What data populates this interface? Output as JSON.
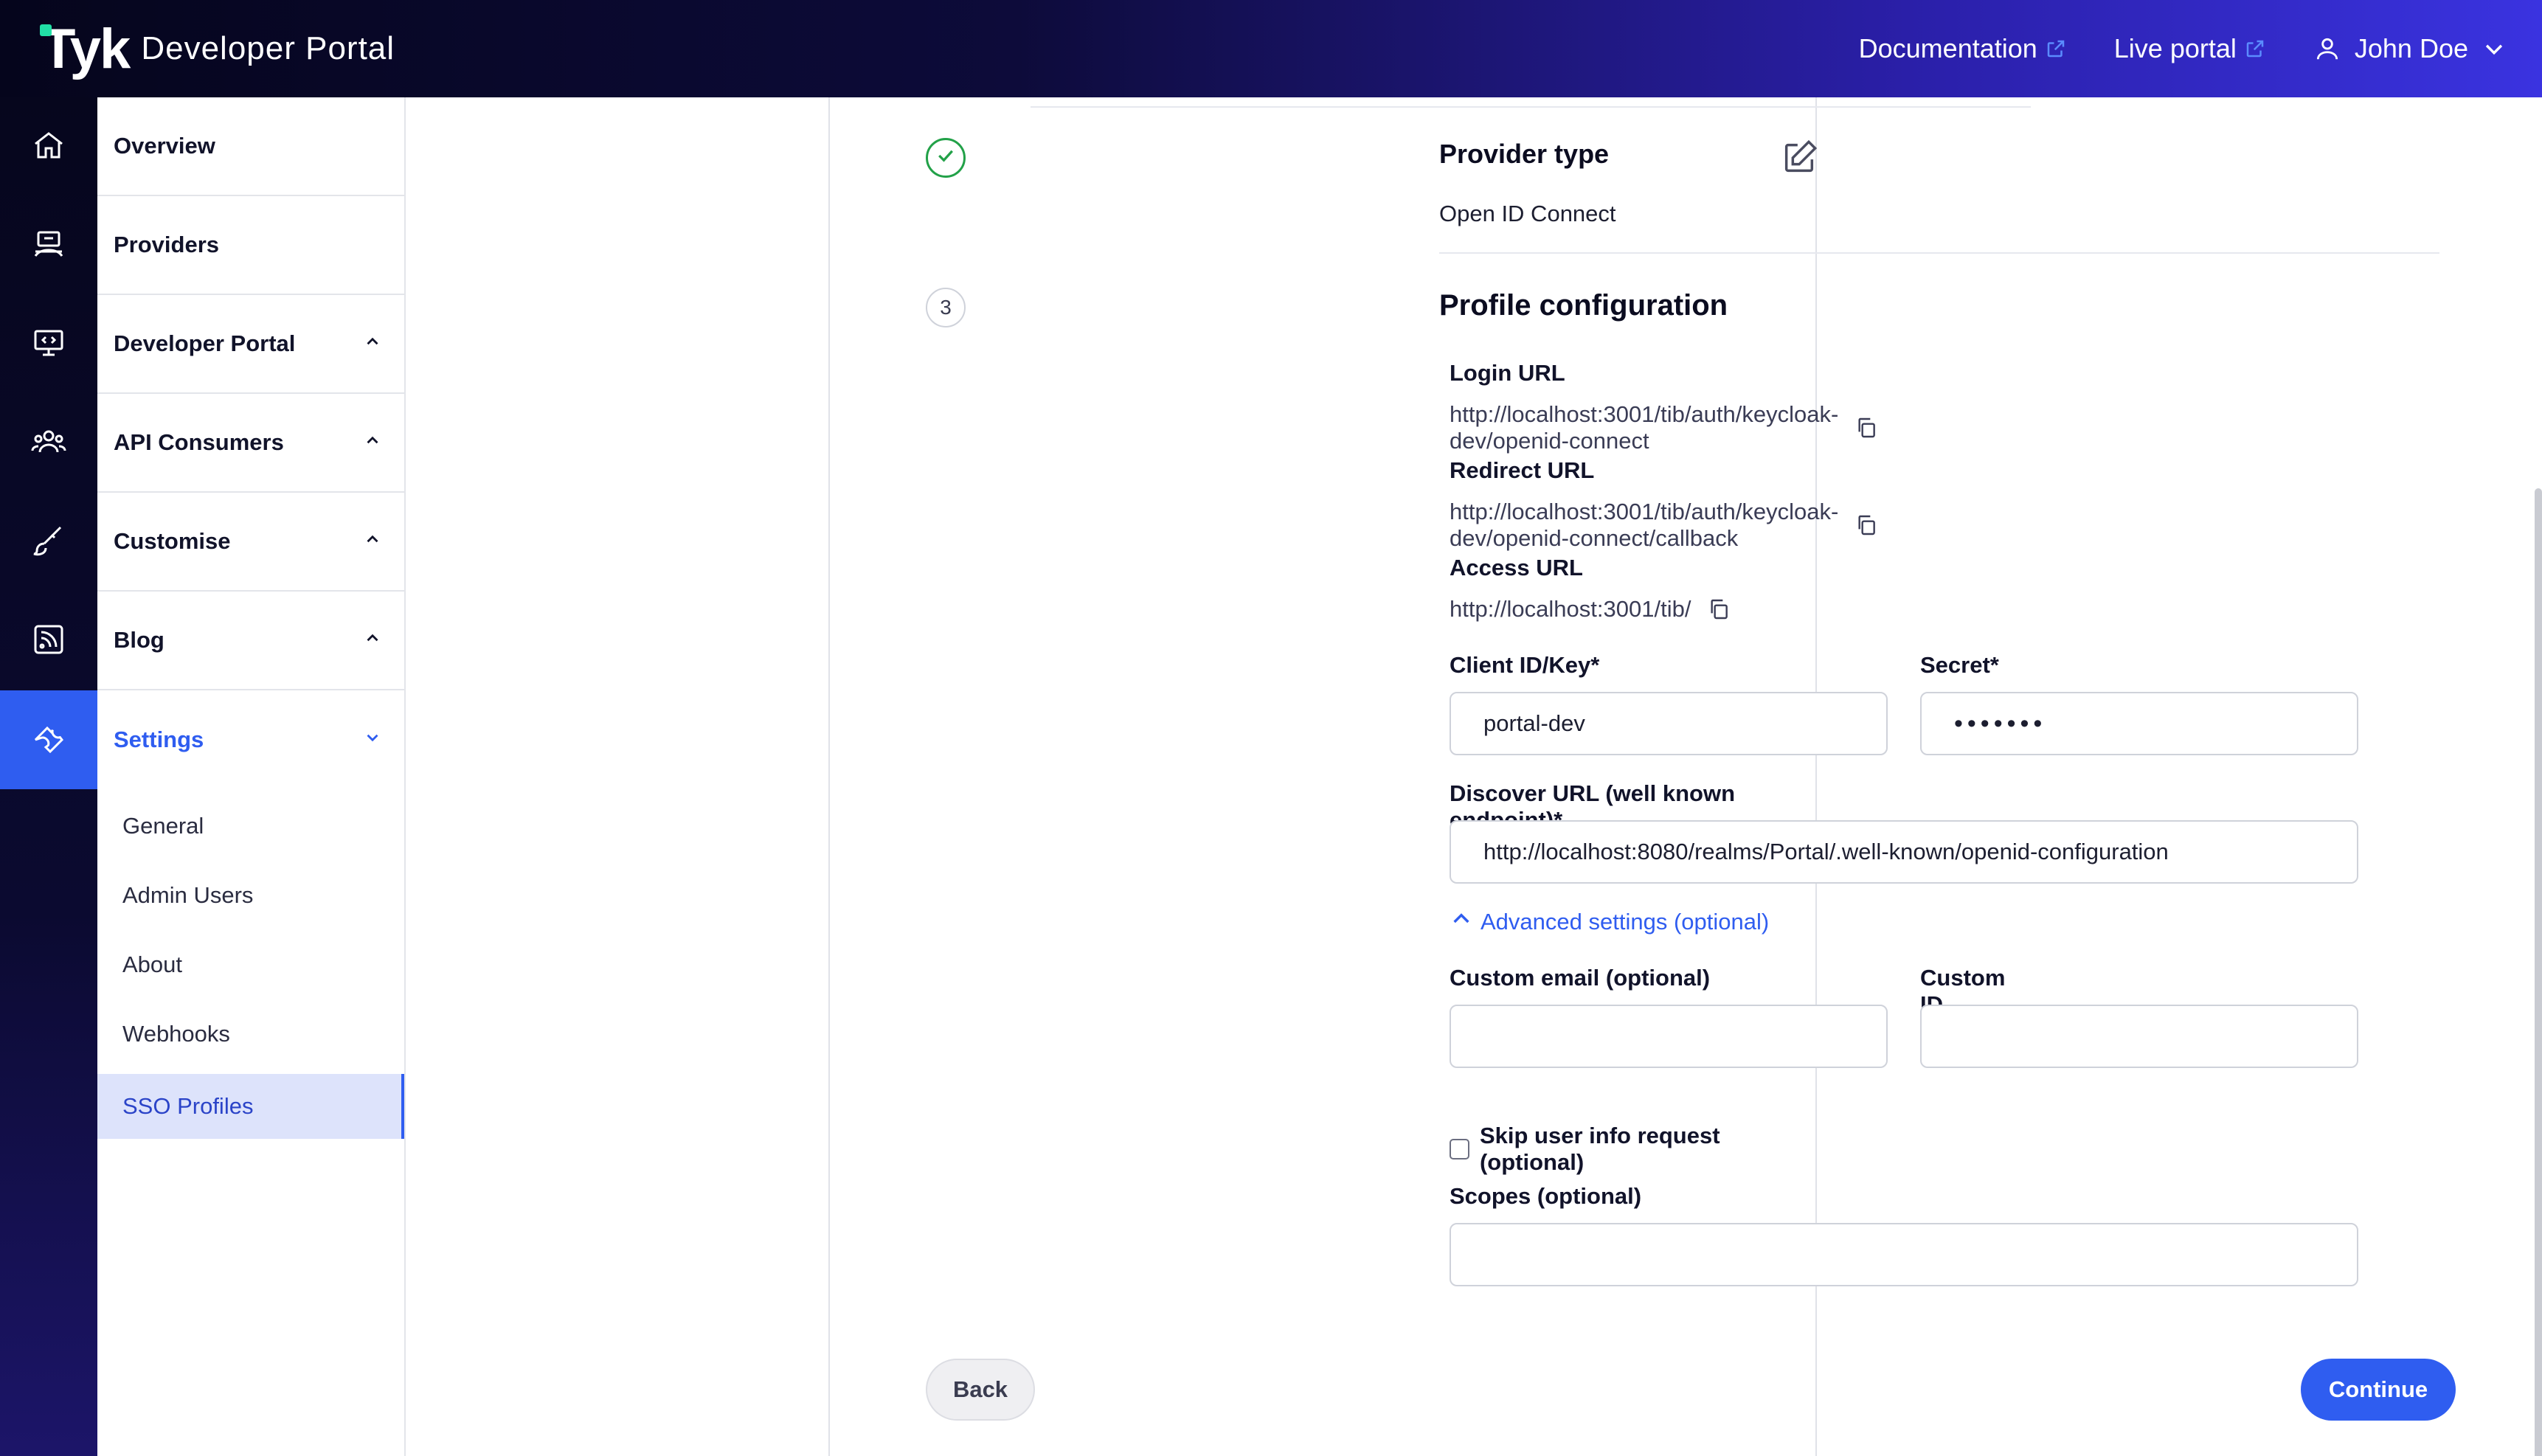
{
  "header": {
    "logo_mark": "Tyk",
    "logo_text": "Developer Portal",
    "links": [
      {
        "label": "Documentation",
        "icon": "external-link-icon"
      },
      {
        "label": "Live portal",
        "icon": "external-link-icon"
      }
    ],
    "user_name": "John Doe"
  },
  "rail": {
    "icons": [
      "home-icon",
      "providers-icon",
      "developer-portal-icon",
      "api-consumers-icon",
      "customise-icon",
      "blog-icon",
      "settings-icon"
    ],
    "active": "settings-icon",
    "active_color": "#2f5df0"
  },
  "sidebar": {
    "items": [
      {
        "label": "Overview"
      },
      {
        "label": "Providers"
      },
      {
        "label": "Developer Portal",
        "caret": "up"
      },
      {
        "label": "API Consumers",
        "caret": "up"
      },
      {
        "label": "Customise",
        "caret": "up"
      },
      {
        "label": "Blog",
        "caret": "up"
      },
      {
        "label": "Settings",
        "caret": "down",
        "active": true
      }
    ],
    "sub_items": [
      {
        "label": "General"
      },
      {
        "label": "Admin Users"
      },
      {
        "label": "About"
      },
      {
        "label": "Webhooks"
      },
      {
        "label": "SSO Profiles",
        "active": true
      }
    ]
  },
  "main": {
    "provider_step": {
      "title": "Provider type",
      "value": "Open ID Connect",
      "status": "completed"
    },
    "profile_step": {
      "number": "3",
      "title": "Profile configuration",
      "login_url_label": "Login URL",
      "login_url": "http://localhost:3001/tib/auth/keycloak-dev/openid-connect",
      "redirect_url_label": "Redirect URL",
      "redirect_url": "http://localhost:3001/tib/auth/keycloak-dev/openid-connect/callback",
      "access_url_label": "Access URL",
      "access_url": "http://localhost:3001/tib/",
      "client_id_label": "Client ID/Key*",
      "client_id_value": "portal-dev",
      "secret_label": "Secret*",
      "secret_value": "•••••••",
      "discover_url_label": "Discover URL (well known endpoint)*",
      "discover_url_value": "http://localhost:8080/realms/Portal/.well-known/openid-configuration",
      "advanced_label": "Advanced settings (optional)",
      "custom_email_label": "Custom email (optional)",
      "custom_email_value": "",
      "custom_id_label": "Custom ID (optional)",
      "custom_id_value": "",
      "skip_userinfo_label": "Skip user info request (optional)",
      "skip_userinfo_checked": false,
      "scopes_label": "Scopes (optional)",
      "scopes_value": ""
    },
    "actions": {
      "back_label": "Back",
      "continue_label": "Continue"
    }
  },
  "colors": {
    "accent": "#2f5df0",
    "success": "#22a148",
    "header_dark": "#05051c"
  }
}
